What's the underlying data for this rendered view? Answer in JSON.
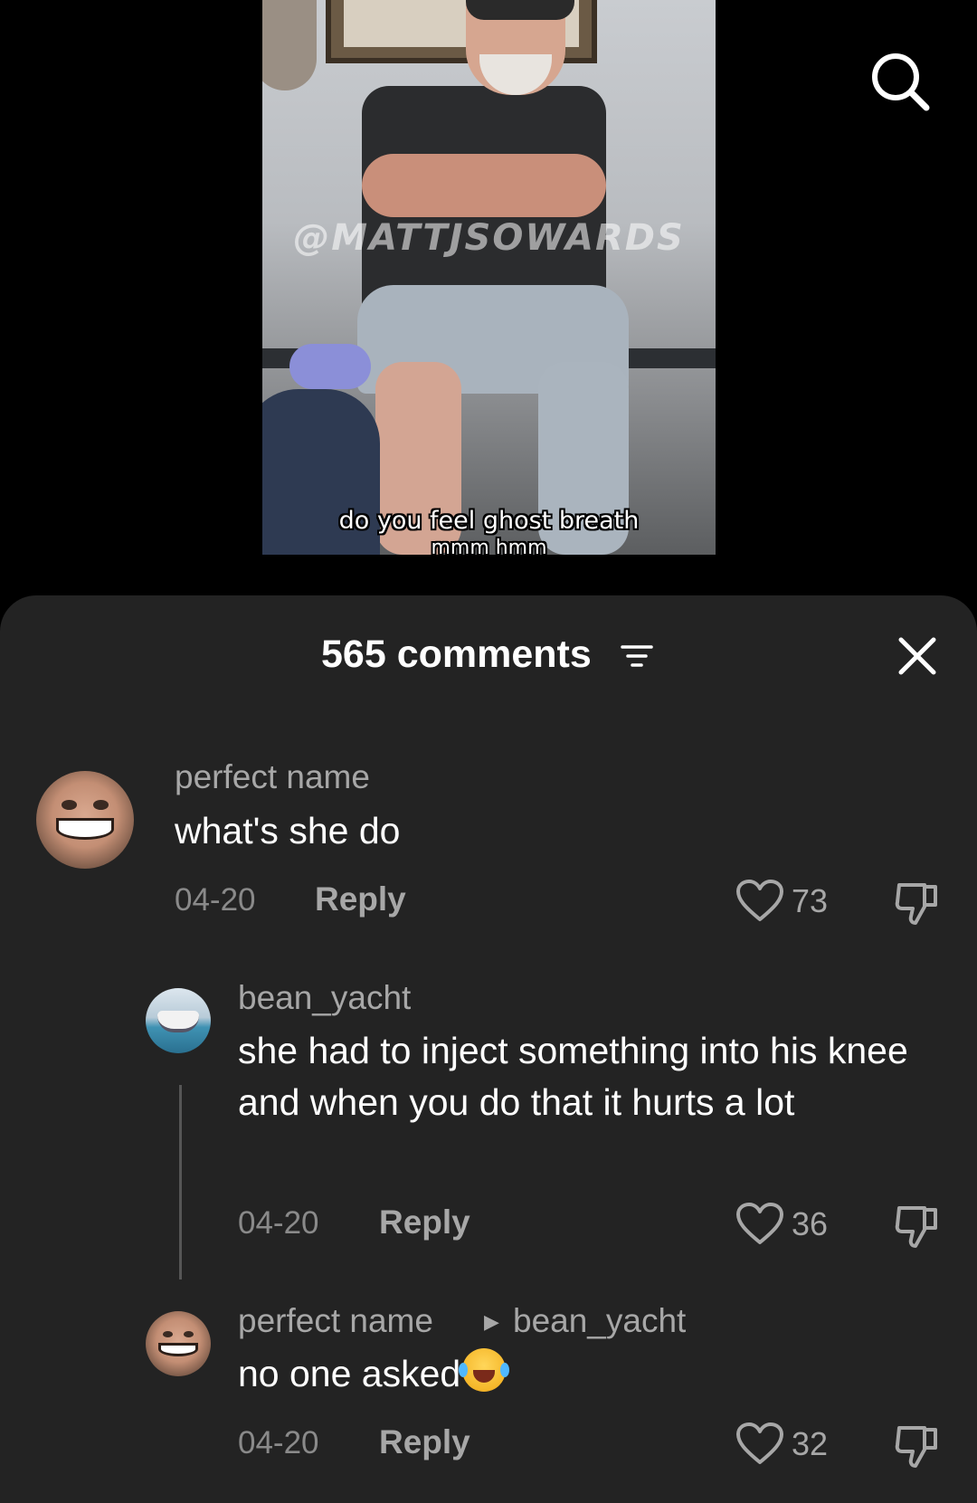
{
  "video": {
    "watermark": "@MATTJSOWARDS",
    "caption_line1": "do you feel ghost breath",
    "caption_line2": "mmm hmm"
  },
  "icons": {
    "search": "search-icon",
    "filter": "filter-icon",
    "close": "close-icon",
    "like": "heart-icon",
    "dislike": "thumbs-down-icon"
  },
  "comments_header": {
    "count_label": "565 comments"
  },
  "comments": [
    {
      "username": "perfect name",
      "text": "what's she do",
      "date": "04-20",
      "reply_label": "Reply",
      "likes": "73"
    },
    {
      "username": "bean_yacht",
      "text": "she had to inject something into his knee and when you do that it hurts a lot",
      "date": "04-20",
      "reply_label": "Reply",
      "likes": "36"
    },
    {
      "username": "perfect name",
      "reply_to": "bean_yacht",
      "text": "no one asked",
      "date": "04-20",
      "reply_label": "Reply",
      "likes": "32"
    }
  ],
  "colors": {
    "sheet_bg": "#232323",
    "secondary_text": "#a7a7a7",
    "primary_text": "#ffffff"
  }
}
